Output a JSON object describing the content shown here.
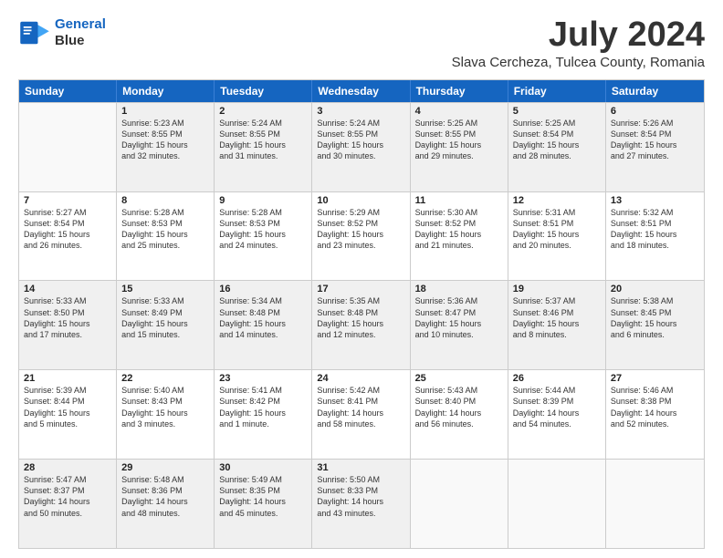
{
  "logo": {
    "line1": "General",
    "line2": "Blue"
  },
  "title": "July 2024",
  "subtitle": "Slava Cercheza, Tulcea County, Romania",
  "weekdays": [
    "Sunday",
    "Monday",
    "Tuesday",
    "Wednesday",
    "Thursday",
    "Friday",
    "Saturday"
  ],
  "rows": [
    [
      {
        "day": "",
        "lines": []
      },
      {
        "day": "1",
        "lines": [
          "Sunrise: 5:23 AM",
          "Sunset: 8:55 PM",
          "Daylight: 15 hours",
          "and 32 minutes."
        ]
      },
      {
        "day": "2",
        "lines": [
          "Sunrise: 5:24 AM",
          "Sunset: 8:55 PM",
          "Daylight: 15 hours",
          "and 31 minutes."
        ]
      },
      {
        "day": "3",
        "lines": [
          "Sunrise: 5:24 AM",
          "Sunset: 8:55 PM",
          "Daylight: 15 hours",
          "and 30 minutes."
        ]
      },
      {
        "day": "4",
        "lines": [
          "Sunrise: 5:25 AM",
          "Sunset: 8:55 PM",
          "Daylight: 15 hours",
          "and 29 minutes."
        ]
      },
      {
        "day": "5",
        "lines": [
          "Sunrise: 5:25 AM",
          "Sunset: 8:54 PM",
          "Daylight: 15 hours",
          "and 28 minutes."
        ]
      },
      {
        "day": "6",
        "lines": [
          "Sunrise: 5:26 AM",
          "Sunset: 8:54 PM",
          "Daylight: 15 hours",
          "and 27 minutes."
        ]
      }
    ],
    [
      {
        "day": "7",
        "lines": [
          "Sunrise: 5:27 AM",
          "Sunset: 8:54 PM",
          "Daylight: 15 hours",
          "and 26 minutes."
        ]
      },
      {
        "day": "8",
        "lines": [
          "Sunrise: 5:28 AM",
          "Sunset: 8:53 PM",
          "Daylight: 15 hours",
          "and 25 minutes."
        ]
      },
      {
        "day": "9",
        "lines": [
          "Sunrise: 5:28 AM",
          "Sunset: 8:53 PM",
          "Daylight: 15 hours",
          "and 24 minutes."
        ]
      },
      {
        "day": "10",
        "lines": [
          "Sunrise: 5:29 AM",
          "Sunset: 8:52 PM",
          "Daylight: 15 hours",
          "and 23 minutes."
        ]
      },
      {
        "day": "11",
        "lines": [
          "Sunrise: 5:30 AM",
          "Sunset: 8:52 PM",
          "Daylight: 15 hours",
          "and 21 minutes."
        ]
      },
      {
        "day": "12",
        "lines": [
          "Sunrise: 5:31 AM",
          "Sunset: 8:51 PM",
          "Daylight: 15 hours",
          "and 20 minutes."
        ]
      },
      {
        "day": "13",
        "lines": [
          "Sunrise: 5:32 AM",
          "Sunset: 8:51 PM",
          "Daylight: 15 hours",
          "and 18 minutes."
        ]
      }
    ],
    [
      {
        "day": "14",
        "lines": [
          "Sunrise: 5:33 AM",
          "Sunset: 8:50 PM",
          "Daylight: 15 hours",
          "and 17 minutes."
        ]
      },
      {
        "day": "15",
        "lines": [
          "Sunrise: 5:33 AM",
          "Sunset: 8:49 PM",
          "Daylight: 15 hours",
          "and 15 minutes."
        ]
      },
      {
        "day": "16",
        "lines": [
          "Sunrise: 5:34 AM",
          "Sunset: 8:48 PM",
          "Daylight: 15 hours",
          "and 14 minutes."
        ]
      },
      {
        "day": "17",
        "lines": [
          "Sunrise: 5:35 AM",
          "Sunset: 8:48 PM",
          "Daylight: 15 hours",
          "and 12 minutes."
        ]
      },
      {
        "day": "18",
        "lines": [
          "Sunrise: 5:36 AM",
          "Sunset: 8:47 PM",
          "Daylight: 15 hours",
          "and 10 minutes."
        ]
      },
      {
        "day": "19",
        "lines": [
          "Sunrise: 5:37 AM",
          "Sunset: 8:46 PM",
          "Daylight: 15 hours",
          "and 8 minutes."
        ]
      },
      {
        "day": "20",
        "lines": [
          "Sunrise: 5:38 AM",
          "Sunset: 8:45 PM",
          "Daylight: 15 hours",
          "and 6 minutes."
        ]
      }
    ],
    [
      {
        "day": "21",
        "lines": [
          "Sunrise: 5:39 AM",
          "Sunset: 8:44 PM",
          "Daylight: 15 hours",
          "and 5 minutes."
        ]
      },
      {
        "day": "22",
        "lines": [
          "Sunrise: 5:40 AM",
          "Sunset: 8:43 PM",
          "Daylight: 15 hours",
          "and 3 minutes."
        ]
      },
      {
        "day": "23",
        "lines": [
          "Sunrise: 5:41 AM",
          "Sunset: 8:42 PM",
          "Daylight: 15 hours",
          "and 1 minute."
        ]
      },
      {
        "day": "24",
        "lines": [
          "Sunrise: 5:42 AM",
          "Sunset: 8:41 PM",
          "Daylight: 14 hours",
          "and 58 minutes."
        ]
      },
      {
        "day": "25",
        "lines": [
          "Sunrise: 5:43 AM",
          "Sunset: 8:40 PM",
          "Daylight: 14 hours",
          "and 56 minutes."
        ]
      },
      {
        "day": "26",
        "lines": [
          "Sunrise: 5:44 AM",
          "Sunset: 8:39 PM",
          "Daylight: 14 hours",
          "and 54 minutes."
        ]
      },
      {
        "day": "27",
        "lines": [
          "Sunrise: 5:46 AM",
          "Sunset: 8:38 PM",
          "Daylight: 14 hours",
          "and 52 minutes."
        ]
      }
    ],
    [
      {
        "day": "28",
        "lines": [
          "Sunrise: 5:47 AM",
          "Sunset: 8:37 PM",
          "Daylight: 14 hours",
          "and 50 minutes."
        ]
      },
      {
        "day": "29",
        "lines": [
          "Sunrise: 5:48 AM",
          "Sunset: 8:36 PM",
          "Daylight: 14 hours",
          "and 48 minutes."
        ]
      },
      {
        "day": "30",
        "lines": [
          "Sunrise: 5:49 AM",
          "Sunset: 8:35 PM",
          "Daylight: 14 hours",
          "and 45 minutes."
        ]
      },
      {
        "day": "31",
        "lines": [
          "Sunrise: 5:50 AM",
          "Sunset: 8:33 PM",
          "Daylight: 14 hours",
          "and 43 minutes."
        ]
      },
      {
        "day": "",
        "lines": []
      },
      {
        "day": "",
        "lines": []
      },
      {
        "day": "",
        "lines": []
      }
    ]
  ]
}
